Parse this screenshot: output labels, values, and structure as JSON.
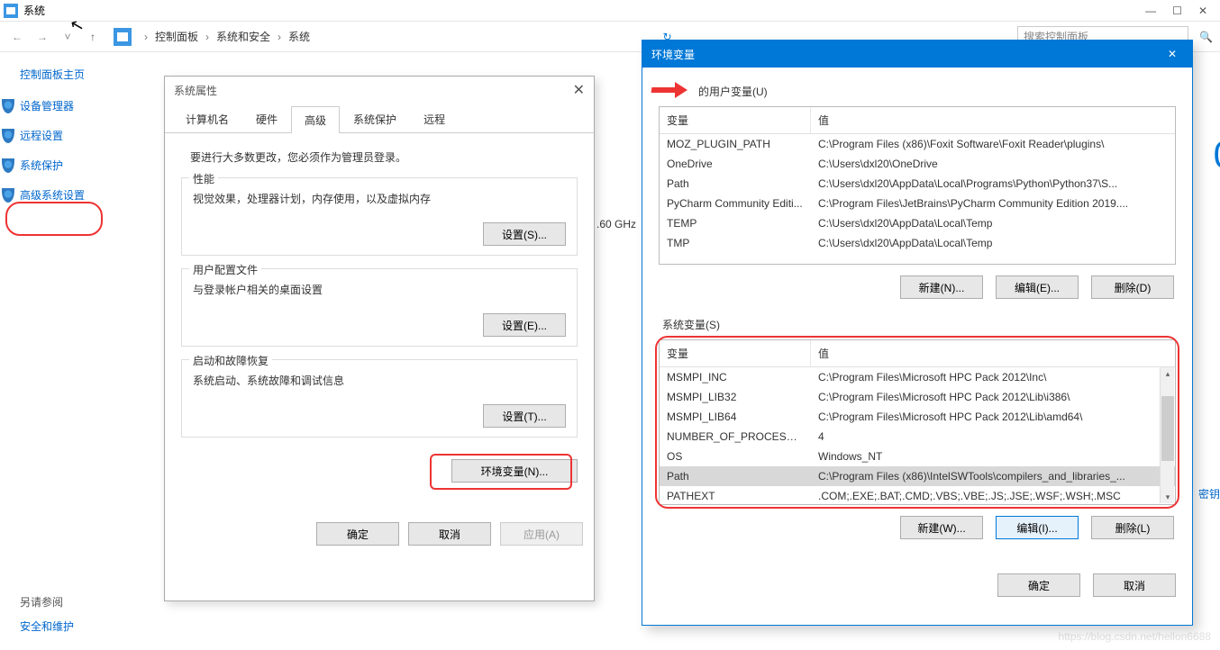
{
  "window": {
    "title": "系统",
    "min": "—",
    "max": "☐",
    "close": "✕"
  },
  "breadcrumb": {
    "items": [
      "控制面板",
      "系统和安全",
      "系统"
    ],
    "search_placeholder": "搜索控制面板"
  },
  "sidebar": {
    "home": "控制面板主页",
    "items": [
      {
        "label": "设备管理器"
      },
      {
        "label": "远程设置"
      },
      {
        "label": "系统保护"
      },
      {
        "label": "高级系统设置"
      }
    ],
    "see_also": "另请参阅",
    "security": "安全和维护"
  },
  "background": {
    "ghz": ".60 GHz"
  },
  "sys_props": {
    "title": "系统属性",
    "tabs": [
      "计算机名",
      "硬件",
      "高级",
      "系统保护",
      "远程"
    ],
    "active_tab": 2,
    "admin_note": "要进行大多数更改，您必须作为管理员登录。",
    "groups": [
      {
        "title": "性能",
        "desc": "视觉效果，处理器计划，内存使用，以及虚拟内存",
        "btn": "设置(S)..."
      },
      {
        "title": "用户配置文件",
        "desc": "与登录帐户相关的桌面设置",
        "btn": "设置(E)..."
      },
      {
        "title": "启动和故障恢复",
        "desc": "系统启动、系统故障和调试信息",
        "btn": "设置(T)..."
      }
    ],
    "env_btn": "环境变量(N)...",
    "footer": {
      "ok": "确定",
      "cancel": "取消",
      "apply": "应用(A)"
    }
  },
  "env": {
    "title": "环境变量",
    "user_section": "的用户变量(U)",
    "sys_section": "系统变量(S)",
    "cols": {
      "name": "变量",
      "value": "值"
    },
    "user_vars": [
      {
        "n": "MOZ_PLUGIN_PATH",
        "v": "C:\\Program Files (x86)\\Foxit Software\\Foxit Reader\\plugins\\"
      },
      {
        "n": "OneDrive",
        "v": "C:\\Users\\dxl20\\OneDrive"
      },
      {
        "n": "Path",
        "v": "C:\\Users\\dxl20\\AppData\\Local\\Programs\\Python\\Python37\\S..."
      },
      {
        "n": "PyCharm Community Editi...",
        "v": "C:\\Program Files\\JetBrains\\PyCharm Community Edition 2019...."
      },
      {
        "n": "TEMP",
        "v": "C:\\Users\\dxl20\\AppData\\Local\\Temp"
      },
      {
        "n": "TMP",
        "v": "C:\\Users\\dxl20\\AppData\\Local\\Temp"
      }
    ],
    "sys_vars": [
      {
        "n": "MSMPI_INC",
        "v": "C:\\Program Files\\Microsoft HPC Pack 2012\\Inc\\"
      },
      {
        "n": "MSMPI_LIB32",
        "v": "C:\\Program Files\\Microsoft HPC Pack 2012\\Lib\\i386\\"
      },
      {
        "n": "MSMPI_LIB64",
        "v": "C:\\Program Files\\Microsoft HPC Pack 2012\\Lib\\amd64\\"
      },
      {
        "n": "NUMBER_OF_PROCESSORS",
        "v": "4"
      },
      {
        "n": "OS",
        "v": "Windows_NT"
      },
      {
        "n": "Path",
        "v": "C:\\Program Files (x86)\\IntelSWTools\\compilers_and_libraries_...",
        "sel": true
      },
      {
        "n": "PATHEXT",
        "v": ".COM;.EXE;.BAT;.CMD;.VBS;.VBE;.JS;.JSE;.WSF;.WSH;.MSC"
      }
    ],
    "btns": {
      "new_u": "新建(N)...",
      "edit_u": "编辑(E)...",
      "del_u": "删除(D)",
      "new_s": "新建(W)...",
      "edit_s": "编辑(I)...",
      "del_s": "删除(L)"
    },
    "footer": {
      "ok": "确定",
      "cancel": "取消"
    }
  },
  "right_link": "密钥",
  "watermark": "https://blog.csdn.net/hellon6688"
}
